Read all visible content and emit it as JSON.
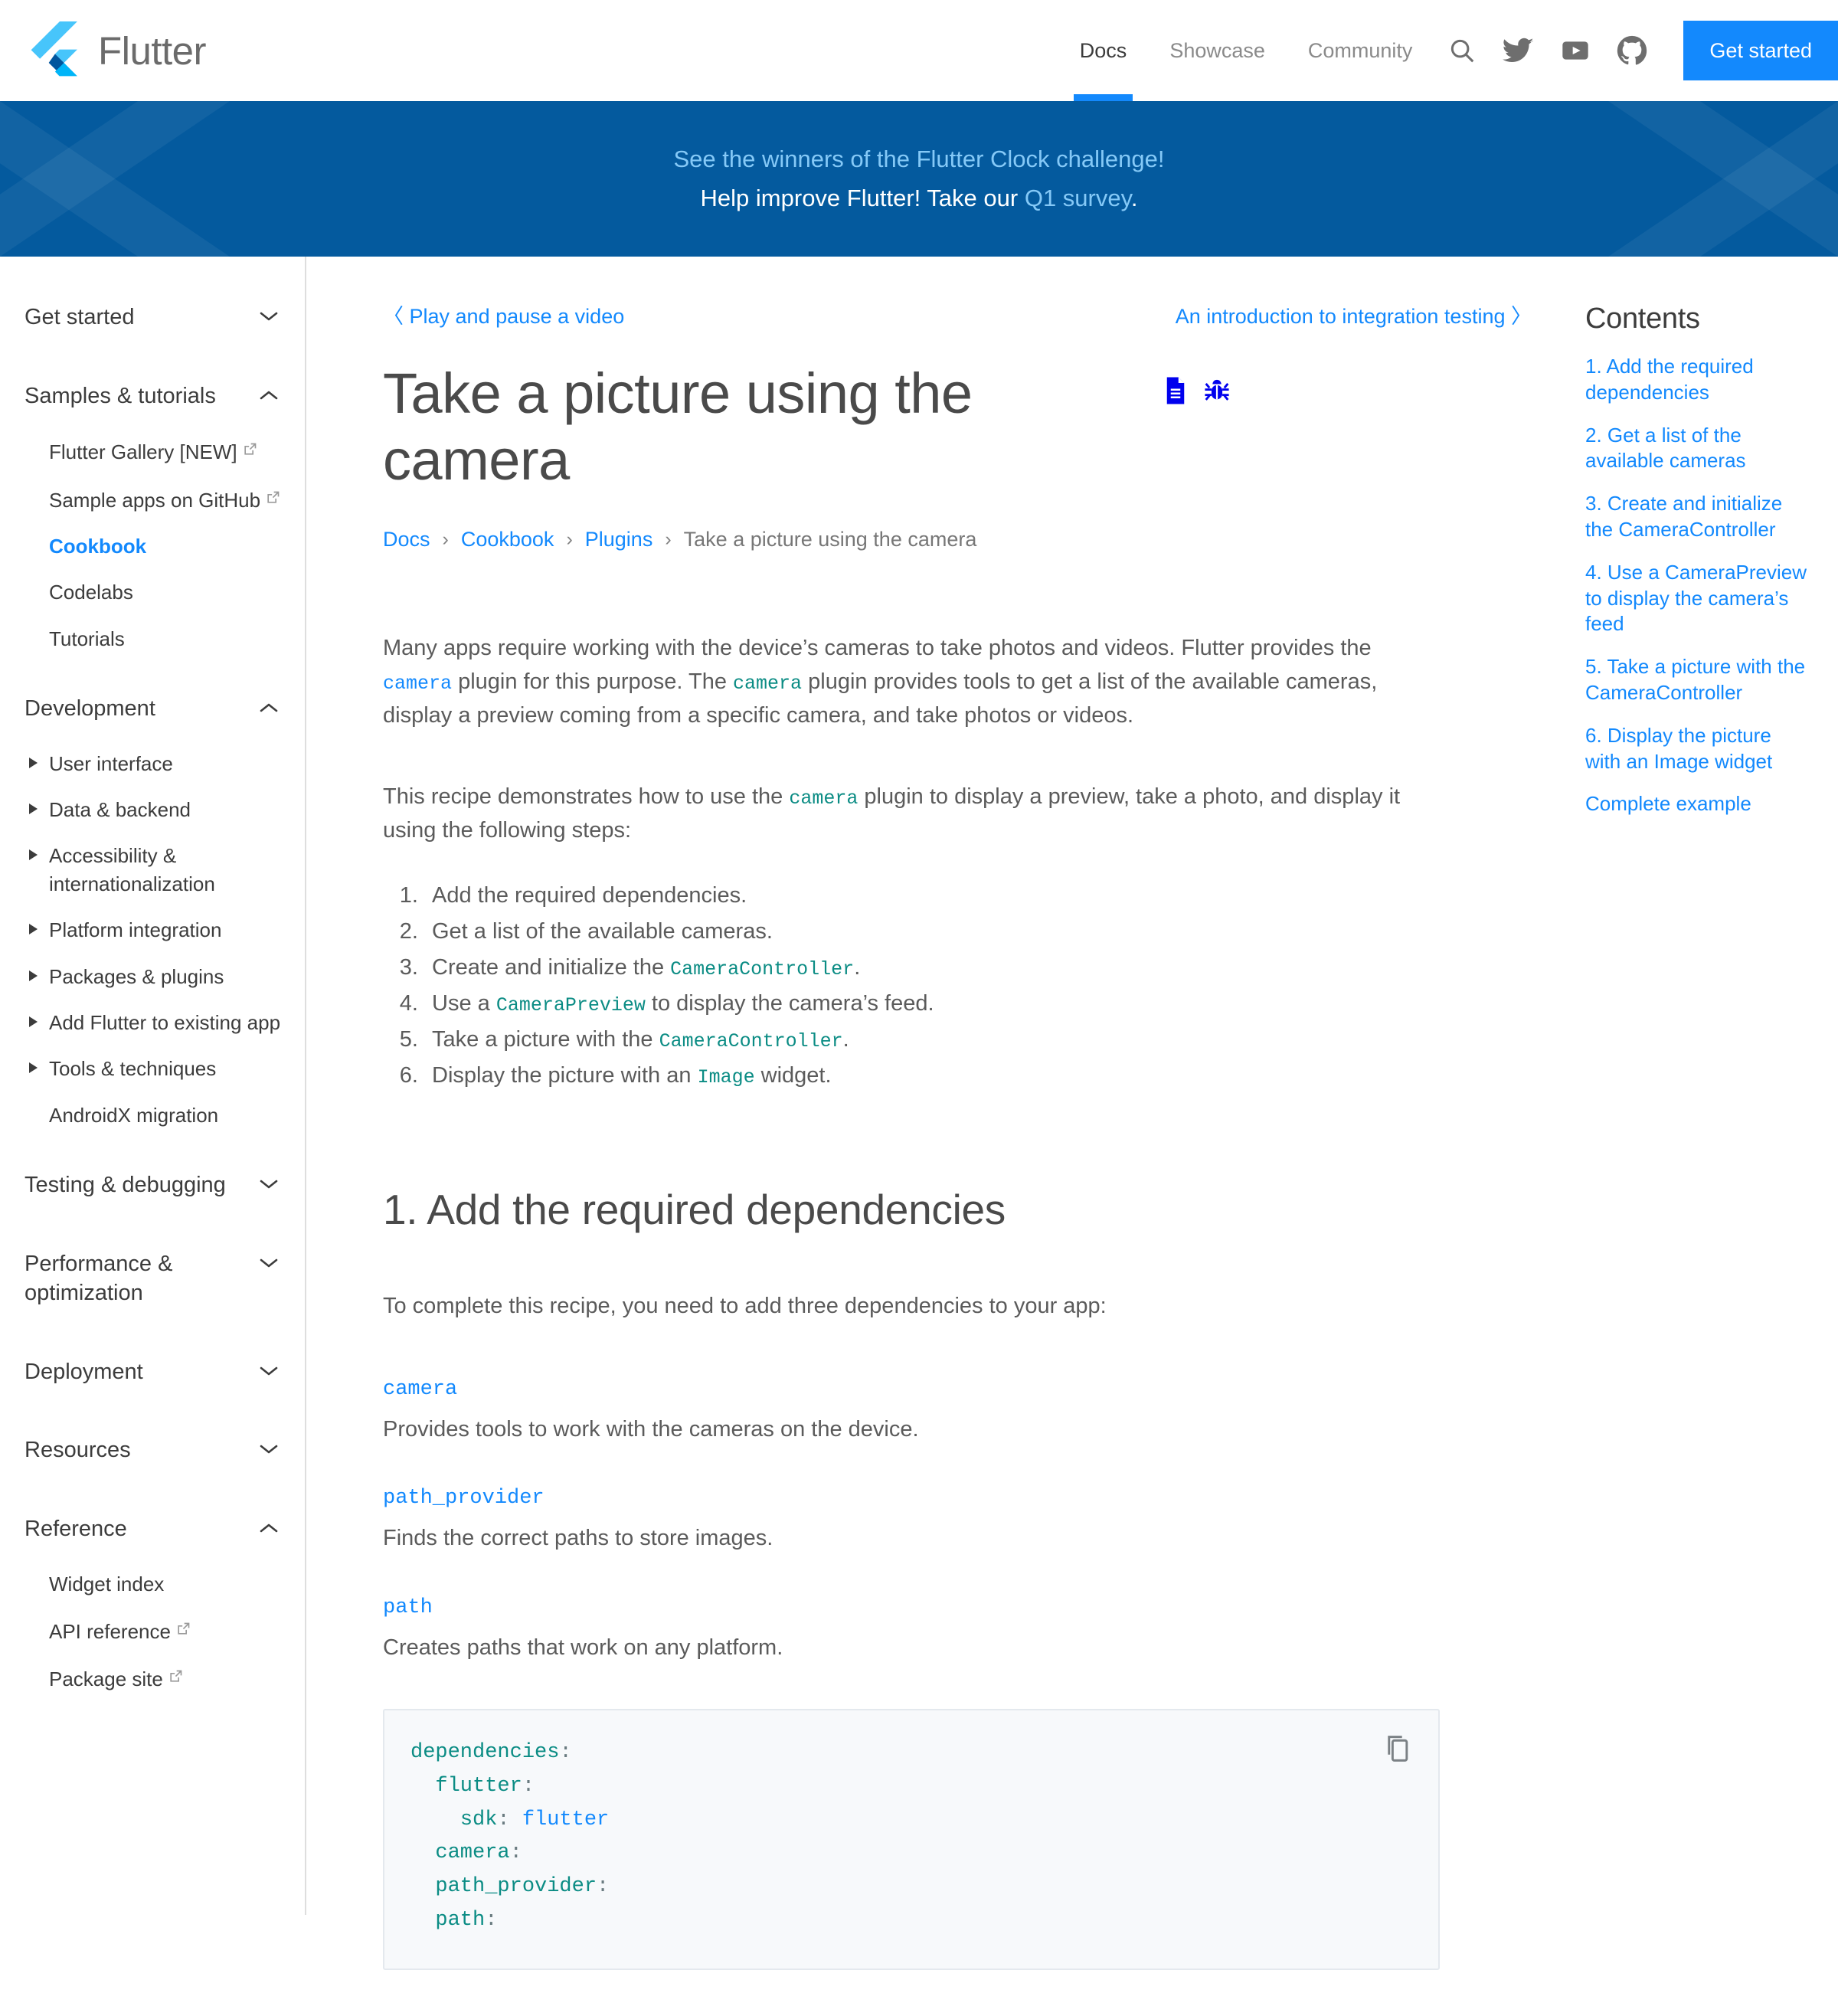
{
  "header": {
    "brand": "Flutter",
    "nav": [
      {
        "label": "Docs",
        "active": true
      },
      {
        "label": "Showcase",
        "active": false
      },
      {
        "label": "Community",
        "active": false
      }
    ],
    "icons": [
      "search-icon",
      "twitter-icon",
      "youtube-icon",
      "github-icon"
    ],
    "cta_label": "Get started",
    "accent_color": "#1389fd"
  },
  "banner": {
    "background_color": "#045a9e",
    "line1_link": "See the winners of the Flutter Clock challenge!",
    "line2_prefix": "Help improve Flutter! Take our ",
    "line2_link": "Q1 survey",
    "line2_suffix": "."
  },
  "sidebar": {
    "sections": [
      {
        "title": "Get started",
        "state": "collapsed",
        "chevron": "chevron-down-icon",
        "items": []
      },
      {
        "title": "Samples & tutorials",
        "state": "expanded",
        "chevron": "chevron-up-icon",
        "items": [
          {
            "label": "Flutter Gallery [NEW]",
            "external": true,
            "current": false,
            "arrow": false
          },
          {
            "label": "Sample apps on GitHub",
            "external": true,
            "current": false,
            "arrow": false
          },
          {
            "label": "Cookbook",
            "external": false,
            "current": true,
            "arrow": false
          },
          {
            "label": "Codelabs",
            "external": false,
            "current": false,
            "arrow": false
          },
          {
            "label": "Tutorials",
            "external": false,
            "current": false,
            "arrow": false
          }
        ]
      },
      {
        "title": "Development",
        "state": "expanded",
        "chevron": "chevron-up-icon",
        "items": [
          {
            "label": "User interface",
            "external": false,
            "current": false,
            "arrow": true
          },
          {
            "label": "Data & backend",
            "external": false,
            "current": false,
            "arrow": true
          },
          {
            "label": "Accessibility & internationalization",
            "external": false,
            "current": false,
            "arrow": true
          },
          {
            "label": "Platform integration",
            "external": false,
            "current": false,
            "arrow": true
          },
          {
            "label": "Packages & plugins",
            "external": false,
            "current": false,
            "arrow": true
          },
          {
            "label": "Add Flutter to existing app",
            "external": false,
            "current": false,
            "arrow": true
          },
          {
            "label": "Tools & techniques",
            "external": false,
            "current": false,
            "arrow": true
          },
          {
            "label": "AndroidX migration",
            "external": false,
            "current": false,
            "arrow": false
          }
        ]
      },
      {
        "title": "Testing & debugging",
        "state": "collapsed",
        "chevron": "chevron-down-icon",
        "items": []
      },
      {
        "title": "Performance & optimization",
        "state": "collapsed",
        "chevron": "chevron-down-icon",
        "items": []
      },
      {
        "title": "Deployment",
        "state": "collapsed",
        "chevron": "chevron-down-icon",
        "items": []
      },
      {
        "title": "Resources",
        "state": "collapsed",
        "chevron": "chevron-down-icon",
        "items": []
      },
      {
        "title": "Reference",
        "state": "expanded",
        "chevron": "chevron-up-icon",
        "items": [
          {
            "label": "Widget index",
            "external": false,
            "current": false,
            "arrow": false
          },
          {
            "label": "API reference",
            "external": true,
            "current": false,
            "arrow": false
          },
          {
            "label": "Package site",
            "external": true,
            "current": false,
            "arrow": false
          }
        ]
      }
    ]
  },
  "doc_nav": {
    "prev_chevron": "〈",
    "prev_label": "Play and pause a video",
    "next_label": "An introduction to integration testing",
    "next_chevron": "〉"
  },
  "article": {
    "title": "Take a picture using the camera",
    "title_icons": [
      "document-icon",
      "bug-icon"
    ],
    "breadcrumb": [
      {
        "label": "Docs",
        "link": true
      },
      {
        "label": "Cookbook",
        "link": true
      },
      {
        "label": "Plugins",
        "link": true
      },
      {
        "label": "Take a picture using the camera",
        "link": false
      }
    ],
    "breadcrumb_separator": "›",
    "para1": {
      "t1": "Many apps require working with the device’s cameras to take photos and videos. Flutter provides the ",
      "code1": "camera",
      "t2": " plugin for this purpose. The ",
      "code2": "camera",
      "t3": " plugin provides tools to get a list of the available cameras, display a preview coming from a specific camera, and take photos or videos."
    },
    "para2": {
      "t1": "This recipe demonstrates how to use the ",
      "code1": "camera",
      "t2": " plugin to display a preview, take a photo, and display it using the following steps:"
    },
    "steps": [
      {
        "t1": "Add the required dependencies.",
        "code": "",
        "t2": ""
      },
      {
        "t1": "Get a list of the available cameras.",
        "code": "",
        "t2": ""
      },
      {
        "t1": "Create and initialize the ",
        "code": "CameraController",
        "t2": "."
      },
      {
        "t1": "Use a ",
        "code": "CameraPreview",
        "t2": " to display the camera’s feed."
      },
      {
        "t1": "Take a picture with the ",
        "code": "CameraController",
        "t2": "."
      },
      {
        "t1": "Display the picture with an ",
        "code": "Image",
        "t2": " widget."
      }
    ],
    "section1": {
      "heading": "1. Add the required dependencies",
      "intro": "To complete this recipe, you need to add three dependencies to your app:",
      "deps": [
        {
          "name": "camera",
          "desc": "Provides tools to work with the cameras on the device."
        },
        {
          "name": "path_provider",
          "desc": "Finds the correct paths to store images."
        },
        {
          "name": "path",
          "desc": "Creates paths that work on any platform."
        }
      ]
    },
    "code_block": {
      "language": "yaml",
      "copy_icon": "copy-icon",
      "lines": [
        {
          "key": "dependencies",
          "punc": ":",
          "indent": 0,
          "value": ""
        },
        {
          "key": "flutter",
          "punc": ":",
          "indent": 1,
          "value": ""
        },
        {
          "key": "sdk",
          "punc": ":",
          "indent": 2,
          "value": " flutter"
        },
        {
          "key": "camera",
          "punc": ":",
          "indent": 1,
          "value": ""
        },
        {
          "key": "path_provider",
          "punc": ":",
          "indent": 1,
          "value": ""
        },
        {
          "key": "path",
          "punc": ":",
          "indent": 1,
          "value": ""
        }
      ]
    }
  },
  "toc": {
    "heading": "Contents",
    "items": [
      "1. Add the required dependencies",
      "2. Get a list of the available cameras",
      "3. Create and initialize the CameraController",
      "4. Use a CameraPreview to display the camera’s feed",
      "5. Take a picture with the CameraController",
      "6. Display the picture with an Image widget",
      "Complete example"
    ]
  }
}
